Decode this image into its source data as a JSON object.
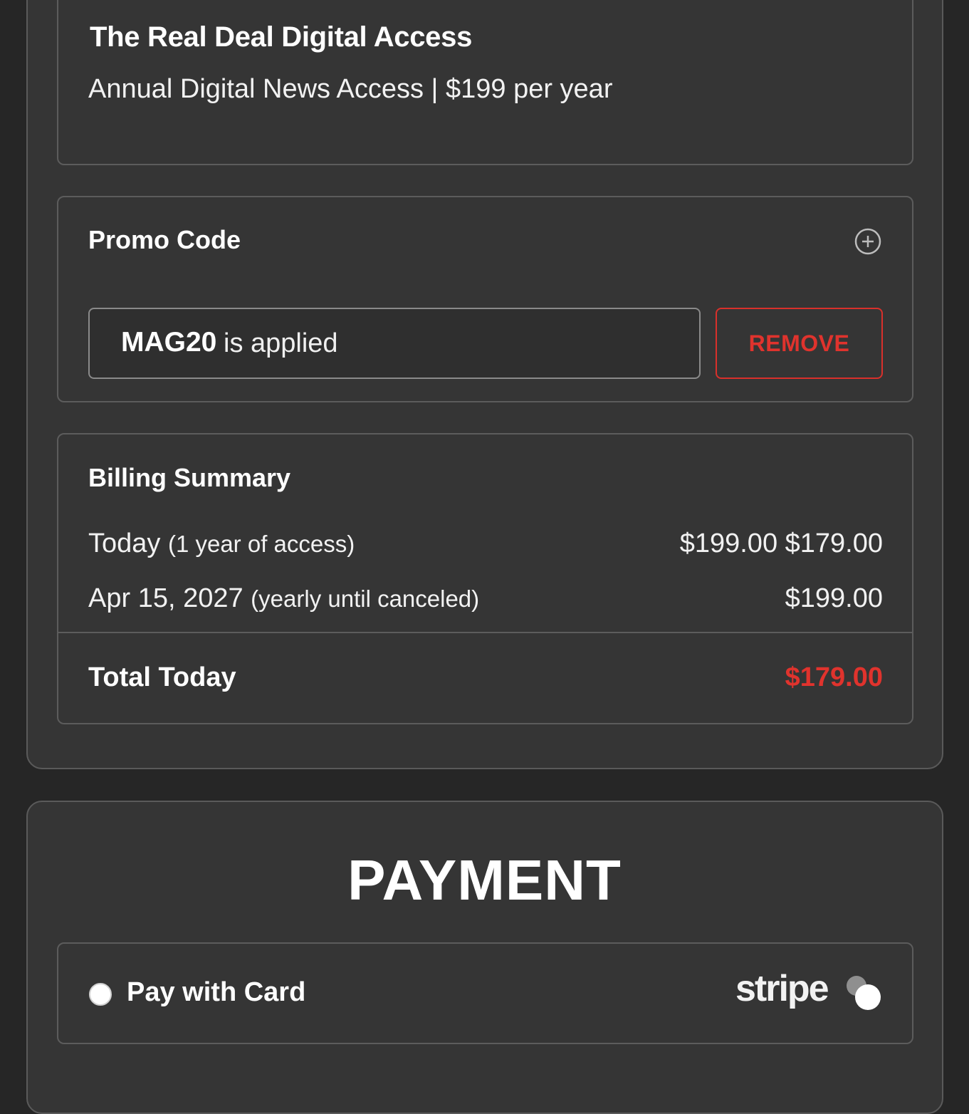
{
  "product": {
    "title": "The Real Deal Digital Access",
    "subtitle": "Annual Digital News Access | $199 per year"
  },
  "promo": {
    "title": "Promo Code",
    "expand_icon": "plus-circle-icon",
    "applied_code": "MAG20",
    "applied_suffix": "is applied",
    "remove_label": "REMOVE"
  },
  "billing": {
    "title": "Billing Summary",
    "rows": [
      {
        "label": "Today",
        "note": "(1 year of access)",
        "value": "$199.00 $179.00"
      },
      {
        "label": "Apr 15, 2027",
        "note": "(yearly until canceled)",
        "value": "$199.00"
      }
    ],
    "total_label": "Total Today",
    "total_value": "$179.00"
  },
  "payment": {
    "title": "PAYMENT",
    "option_label": "Pay with Card",
    "provider_logo": "stripe",
    "provider_icon": "stripe-link-icon"
  },
  "colors": {
    "background": "#262626",
    "card": "#353535",
    "border": "#5c5c5c",
    "accent_red": "#e0332d",
    "text": "#ffffff"
  }
}
